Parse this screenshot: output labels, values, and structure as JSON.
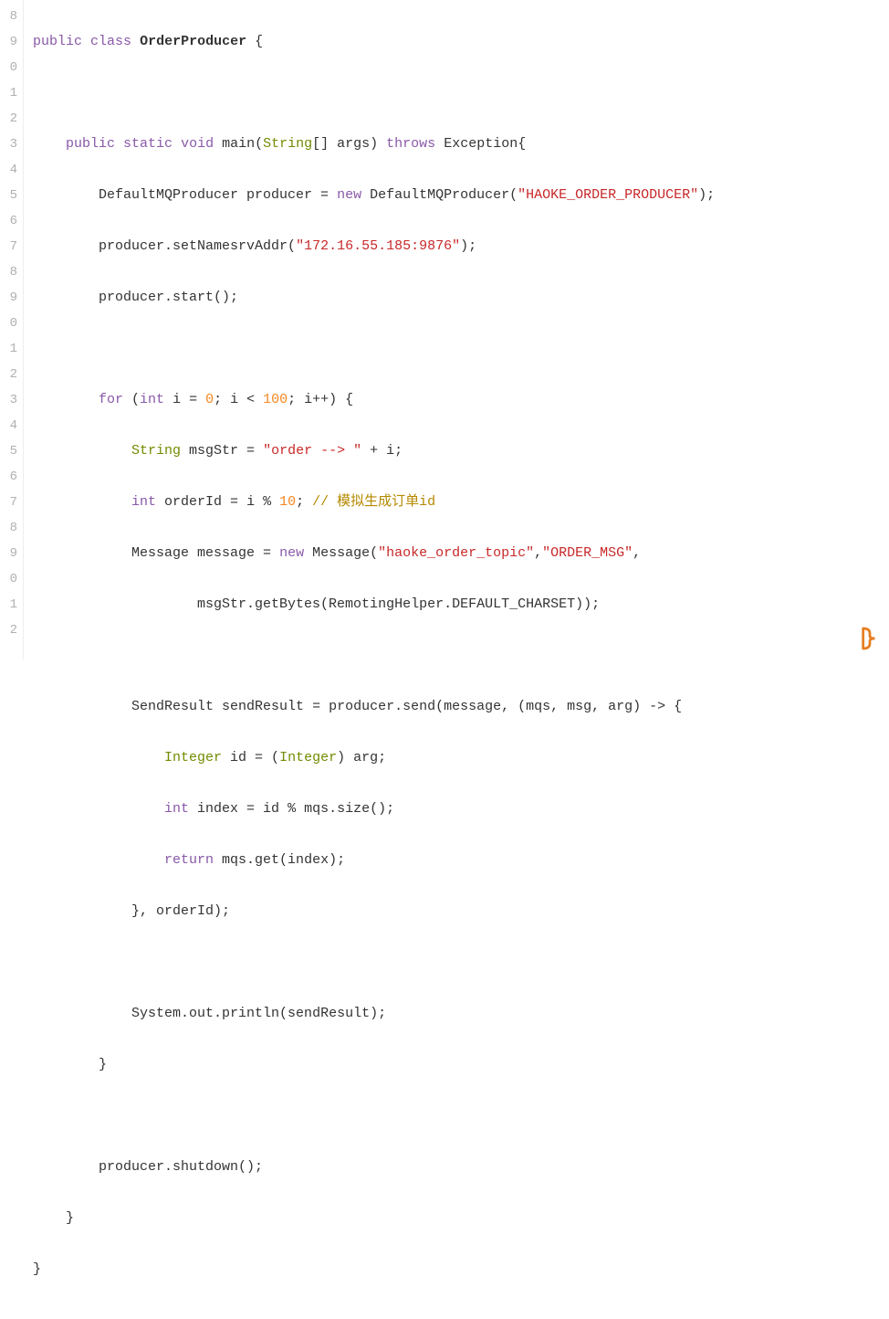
{
  "gutter": [
    "8",
    "9",
    "0",
    "1",
    "2",
    "3",
    "4",
    "5",
    "6",
    "7",
    "8",
    "9",
    "0",
    "1",
    "2",
    "3",
    "4",
    "5",
    "6",
    "7",
    "8",
    "9",
    "0",
    "1",
    "2"
  ],
  "code": {
    "l8_kw1": "public",
    "l8_kw2": "class",
    "l8_cls": "OrderProducer",
    "l8_p": " {",
    "l10_kw1": "public",
    "l10_kw2": "static",
    "l10_kw3": "void",
    "l10_main": "main",
    "l10_p1": "(",
    "l10_type": "String",
    "l10_args": "[] args) ",
    "l10_kw4": "throws",
    "l10_exc": " Exception{",
    "l11_a": "DefaultMQProducer producer = ",
    "l11_kw": "new",
    "l11_b": " DefaultMQProducer(",
    "l11_str": "\"HAOKE_ORDER_PRODUCER\"",
    "l11_c": ");",
    "l12_a": "producer.setNamesrvAddr(",
    "l12_str": "\"172.16.55.185:9876\"",
    "l12_b": ");",
    "l13": "producer.start();",
    "l15_kw1": "for",
    "l15_a": " (",
    "l15_kw2": "int",
    "l15_b": " i = ",
    "l15_n1": "0",
    "l15_c": "; i < ",
    "l15_n2": "100",
    "l15_d": "; i++) {",
    "l16_type": "String",
    "l16_a": " msgStr = ",
    "l16_str": "\"order --> \"",
    "l16_b": " + i;",
    "l17_kw": "int",
    "l17_a": " orderId = i % ",
    "l17_n": "10",
    "l17_b": "; ",
    "l17_cmt": "// 模拟生成订单id",
    "l18_a": "Message message = ",
    "l18_kw": "new",
    "l18_b": " Message(",
    "l18_s1": "\"haoke_order_topic\"",
    "l18_c": ",",
    "l18_s2": "\"ORDER_MSG\"",
    "l18_d": ",",
    "l19": "msgStr.getBytes(RemotingHelper.DEFAULT_CHARSET));",
    "l21": "SendResult sendResult = producer.send(message, (mqs, msg, arg) -> {",
    "l22_type": "Integer",
    "l22_a": " id = (",
    "l22_type2": "Integer",
    "l22_b": ") arg;",
    "l23_kw": "int",
    "l23_a": " index = id % mqs.size();",
    "l24_kw": "return",
    "l24_a": " mqs.get(index);",
    "l25": "}, orderId);",
    "l27": "System.out.println(sendResult);",
    "l28": "}",
    "l30": "producer.shutdown();",
    "l31": "}",
    "l32": "}"
  }
}
